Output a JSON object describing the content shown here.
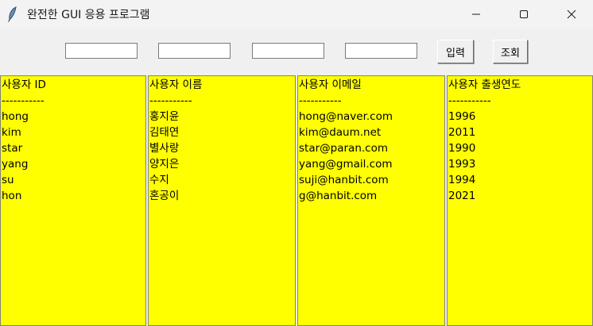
{
  "window": {
    "title": "완전한 GUI 응용 프로그램",
    "icon": "feather-icon"
  },
  "toolbar": {
    "inputs": [
      {
        "value": "",
        "placeholder": ""
      },
      {
        "value": "",
        "placeholder": ""
      },
      {
        "value": "",
        "placeholder": ""
      },
      {
        "value": "",
        "placeholder": ""
      }
    ],
    "insert_label": "입력",
    "query_label": "조회"
  },
  "colors": {
    "list_background": "#ffff00"
  },
  "lists": {
    "id": [
      "사용자 ID",
      "-----------",
      "hong",
      "kim",
      "star",
      "yang",
      "su",
      "hon"
    ],
    "name": [
      "사용자 이름",
      "-----------",
      "홍지윤",
      "김태연",
      "별사랑",
      "양지은",
      "수지",
      "혼공이"
    ],
    "email": [
      "사용자 이메일",
      "-----------",
      "hong@naver.com",
      "kim@daum.net",
      "star@paran.com",
      "yang@gmail.com",
      "suji@hanbit.com",
      "g@hanbit.com"
    ],
    "birth_year": [
      "사용자 출생연도",
      "-----------",
      "1996",
      "2011",
      "1990",
      "1993",
      "1994",
      "2021"
    ]
  }
}
